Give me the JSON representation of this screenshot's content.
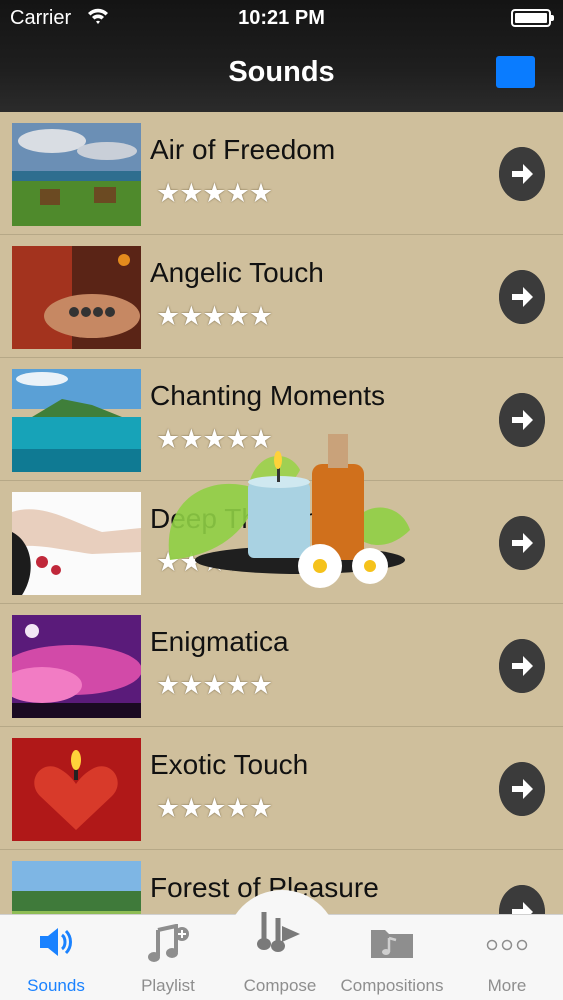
{
  "status": {
    "carrier": "Carrier",
    "time": "10:21 PM"
  },
  "nav": {
    "title": "Sounds"
  },
  "sounds": [
    {
      "title": "Air of Freedom",
      "rating": "★★★★★"
    },
    {
      "title": "Angelic Touch",
      "rating": "★★★★★"
    },
    {
      "title": "Chanting Moments",
      "rating": "★★★★★"
    },
    {
      "title": "Deep Thoughts",
      "rating": "★★★★★"
    },
    {
      "title": "Enigmatica",
      "rating": "★★★★★"
    },
    {
      "title": "Exotic Touch",
      "rating": "★★★★★"
    },
    {
      "title": "Forest of Pleasure",
      "rating": ""
    }
  ],
  "tabs": [
    {
      "label": "Sounds",
      "icon": "speaker-icon"
    },
    {
      "label": "Playlist",
      "icon": "music-note-plus-icon"
    },
    {
      "label": "Compose",
      "icon": "music-note-compose-icon"
    },
    {
      "label": "Compositions",
      "icon": "folder-music-icon"
    },
    {
      "label": "More",
      "icon": "ellipsis-icon"
    }
  ],
  "colors": {
    "accent": "#1a82ff",
    "nav_button": "#0a7cff",
    "list_bg": "#cfbf9c"
  }
}
